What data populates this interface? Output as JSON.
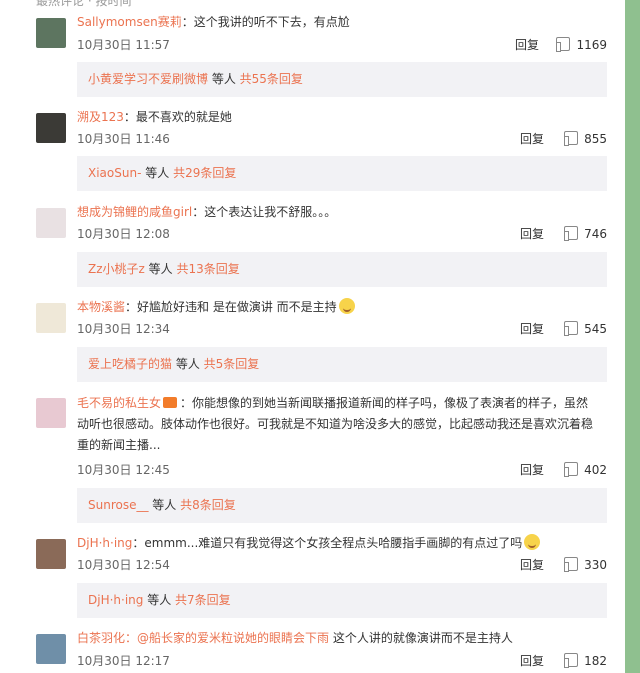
{
  "header_cut": "最热评论 · 按时间",
  "comments": [
    {
      "user": "Sallymomsen赛莉",
      "text": "：这个我讲的听不下去，有点尬",
      "time": "10月30日 11:57",
      "reply_label": "回复",
      "likes": "1169",
      "sub_user": "小黄爱学习不爱刷微博",
      "sub_mid": " 等人 ",
      "sub_count": "共55条回复",
      "avatar_color": "#5d7560"
    },
    {
      "user": "溯及123",
      "text": "：最不喜欢的就是她",
      "time": "10月30日 11:46",
      "reply_label": "回复",
      "likes": "855",
      "sub_user": "XiaoSun-",
      "sub_mid": " 等人 ",
      "sub_count": "共29条回复",
      "avatar_color": "#3b3a36"
    },
    {
      "user": "想成为锦鲤的咸鱼girl",
      "text": "：这个表达让我不舒服。。。",
      "time": "10月30日 12:08",
      "reply_label": "回复",
      "likes": "746",
      "sub_user": "Zz小桃子z",
      "sub_mid": " 等人 ",
      "sub_count": "共13条回复",
      "avatar_color": "#e9e1e3"
    },
    {
      "user": "本物溪酱",
      "text": "：好尴尬好违和 是在做演讲 而不是主持",
      "time": "10月30日 12:34",
      "reply_label": "回复",
      "likes": "545",
      "sub_user": "爱上吃橘子的猫",
      "sub_mid": " 等人 ",
      "sub_count": "共5条回复",
      "avatar_color": "#efe8d8"
    },
    {
      "user": "毛不易的私生女",
      "text_line1": "：你能想像的到她当新闻联播报道新闻的样子吗，像极了表演者的样子，虽然",
      "text_line2": "动听也很感动。肢体动作也很好。可我就是不知道为啥没多大的感觉，比起感动我还是喜欢沉着稳",
      "text_line3": "重的新闻主播...",
      "time": "10月30日 12:45",
      "reply_label": "回复",
      "likes": "402",
      "sub_user": "Sunrose__",
      "sub_mid": " 等人 ",
      "sub_count": "共8条回复",
      "avatar_color": "#e8c9d2"
    },
    {
      "user": "DjH·h·ing",
      "text": "：emmm...难道只有我觉得这个女孩全程点头哈腰指手画脚的有点过了吗",
      "time": "10月30日 12:54",
      "reply_label": "回复",
      "likes": "330",
      "sub_user": "DjH·h·ing",
      "sub_mid": " 等人 ",
      "sub_count": "共7条回复",
      "avatar_color": "#8a6a58"
    },
    {
      "user": "白茶羽化",
      "mention": "：@船长家的爱米粒说她的眼睛会下雨",
      "text": " 这个人讲的就像演讲而不是主持人",
      "time": "10月30日 12:17",
      "reply_label": "回复",
      "likes": "182",
      "avatar_color": "#6f8fa8"
    }
  ]
}
